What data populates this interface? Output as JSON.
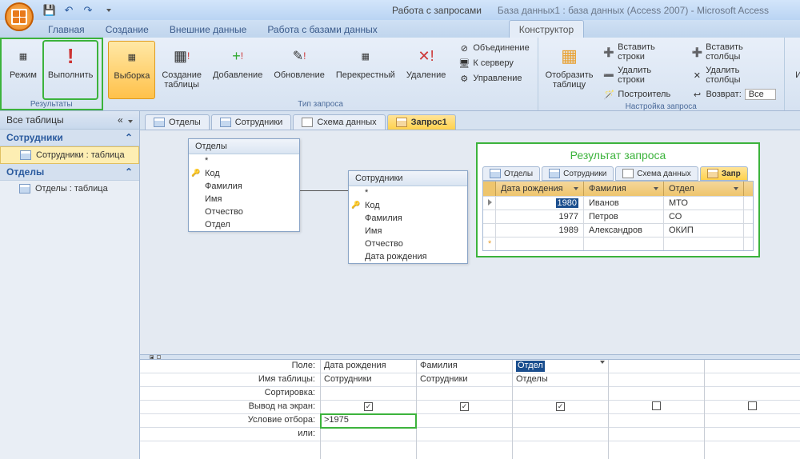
{
  "title": {
    "contextual": "Работа с запросами",
    "main": "База данных1 : база данных (Access 2007) - Microsoft Access"
  },
  "tabs": {
    "home": "Главная",
    "create": "Создание",
    "external": "Внешние данные",
    "dbtools": "Работа с базами данных",
    "ctx": "Конструктор"
  },
  "ribbon": {
    "results": {
      "label": "Результаты",
      "view": "Режим",
      "run": "Выполнить"
    },
    "qtype": {
      "label": "Тип запроса",
      "select": "Выборка",
      "maketable": "Создание\nтаблицы",
      "append": "Добавление",
      "update": "Обновление",
      "crosstab": "Перекрестный",
      "delete": "Удаление",
      "union": "Объединение",
      "passthrough": "К серверу",
      "datadef": "Управление"
    },
    "setup": {
      "label": "Настройка запроса",
      "showtable": "Отобразить\nтаблицу",
      "insrows": "Вставить строки",
      "delrows": "Удалить строки",
      "builder": "Построитель",
      "inscols": "Вставить столбцы",
      "delcols": "Удалить столбцы",
      "return": "Возврат:",
      "returnval": "Все"
    },
    "totals": "Итоги"
  },
  "nav": {
    "head": "Все таблицы",
    "g1": "Сотрудники",
    "i1": "Сотрудники : таблица",
    "g2": "Отделы",
    "i2": "Отделы : таблица"
  },
  "doctabs": {
    "t1": "Отделы",
    "t2": "Сотрудники",
    "t3": "Схема данных",
    "t4": "Запрос1"
  },
  "diagram": {
    "box1": {
      "title": "Отделы",
      "star": "*",
      "f1": "Код",
      "f2": "Фамилия",
      "f3": "Имя",
      "f4": "Отчество",
      "f5": "Отдел"
    },
    "box2": {
      "title": "Сотрудники",
      "star": "*",
      "f1": "Код",
      "f2": "Фамилия",
      "f3": "Имя",
      "f4": "Отчество",
      "f5": "Дата рождения"
    }
  },
  "result": {
    "title": "Результат запроса",
    "tabs": {
      "t1": "Отделы",
      "t2": "Сотрудники",
      "t3": "Схема данных",
      "t4": "Запр"
    },
    "cols": {
      "c1": "Дата рождения",
      "c2": "Фамилия",
      "c3": "Отдел"
    },
    "rows": [
      {
        "c1": "1980",
        "c2": "Иванов",
        "c3": "МТО"
      },
      {
        "c1": "1977",
        "c2": "Петров",
        "c3": "СО"
      },
      {
        "c1": "1989",
        "c2": "Александров",
        "c3": "ОКИП"
      }
    ]
  },
  "grid": {
    "labels": {
      "field": "Поле:",
      "table": "Имя таблицы:",
      "sort": "Сортировка:",
      "show": "Вывод на экран:",
      "criteria": "Условие отбора:",
      "or": "или:"
    },
    "c1": {
      "field": "Дата рождения",
      "table": "Сотрудники",
      "criteria": ">1975"
    },
    "c2": {
      "field": "Фамилия",
      "table": "Сотрудники"
    },
    "c3": {
      "field": "Отдел",
      "table": "Отделы"
    }
  }
}
